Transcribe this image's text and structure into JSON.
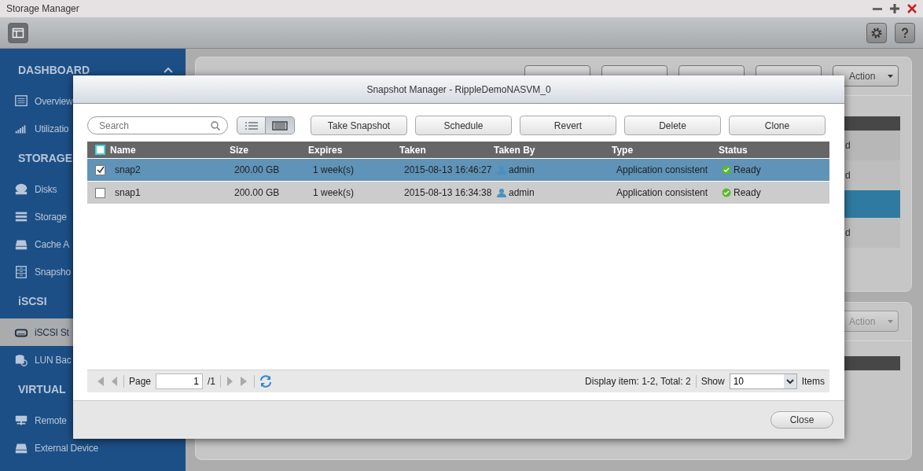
{
  "window": {
    "title": "Storage Manager"
  },
  "sidebar": {
    "sections": [
      {
        "label": "DASHBOARD",
        "items": [
          {
            "label": "Overview",
            "selected": false
          },
          {
            "label": "Utilizatio",
            "selected": false
          }
        ]
      },
      {
        "label": "STORAGE",
        "items": [
          {
            "label": "Disks",
            "selected": false
          },
          {
            "label": "Storage",
            "selected": false
          },
          {
            "label": "Cache A",
            "selected": false
          },
          {
            "label": "Snapsho",
            "selected": false
          }
        ]
      },
      {
        "label": "iSCSI",
        "items": [
          {
            "label": "iSCSI St",
            "selected": true
          },
          {
            "label": "LUN Bac",
            "selected": false
          }
        ]
      },
      {
        "label": "VIRTUAL",
        "items": [
          {
            "label": "Remote",
            "selected": false
          },
          {
            "label": "External Device",
            "selected": false
          }
        ]
      }
    ]
  },
  "background_panels": [
    {
      "action_button": {
        "label": "Action",
        "disabled": false
      },
      "rows": [
        {
          "column_1": "d",
          "selected": false
        },
        {
          "column_1": "d",
          "selected": false
        },
        {
          "selected": true
        },
        {
          "column_1": "d",
          "selected": false
        }
      ]
    },
    {
      "action_button": {
        "label": "Action",
        "disabled": true
      }
    }
  ],
  "dialog": {
    "title": "Snapshot Manager - RippleDemoNASVM_0",
    "search": {
      "placeholder": "Search"
    },
    "view_modes": [
      {
        "kind": "list",
        "selected": false
      },
      {
        "kind": "detail",
        "selected": true
      }
    ],
    "actions": [
      "Take Snapshot",
      "Schedule",
      "Revert",
      "Delete",
      "Clone"
    ],
    "table": {
      "select_all": false,
      "columns": [
        "Name",
        "Size",
        "Expires",
        "Taken",
        "Taken By",
        "Type",
        "Status"
      ],
      "rows": [
        {
          "checked": true,
          "selected": true,
          "name": "snap2",
          "size": "200.00 GB",
          "expires": "1 week(s)",
          "taken": "2015-08-13 16:46:27",
          "taken_by": "admin",
          "type": "Application consistent",
          "status": "Ready"
        },
        {
          "checked": false,
          "selected": false,
          "name": "snap1",
          "size": "200.00 GB",
          "expires": "1 week(s)",
          "taken": "2015-08-13 16:34:38",
          "taken_by": "admin",
          "type": "Application consistent",
          "status": "Ready"
        }
      ]
    },
    "pagination": {
      "page_label": "Page",
      "page": "1",
      "total_pages": "/1",
      "summary": "Display item: 1-2, Total: 2",
      "show_label": "Show",
      "page_size": "10",
      "items_label": "Items"
    },
    "close_button": "Close"
  }
}
